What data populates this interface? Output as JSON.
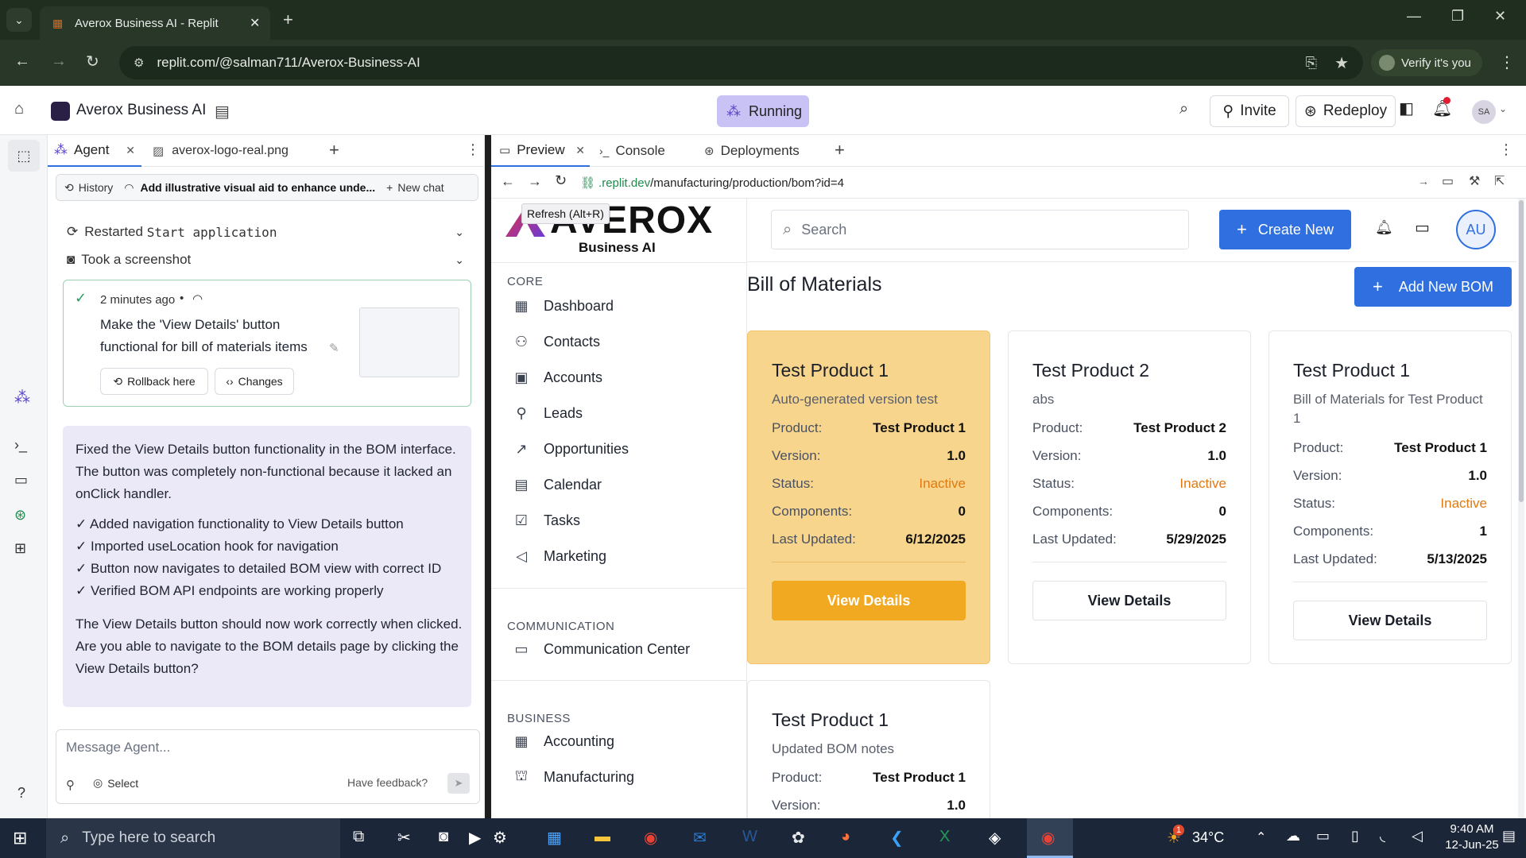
{
  "browser": {
    "tab_title": "Averox Business AI - Replit",
    "url": "replit.com/@salman711/Averox-Business-AI",
    "verify_label": "Verify it's you"
  },
  "replit": {
    "project_name": "Averox Business AI",
    "running_label": "Running",
    "invite_label": "Invite",
    "redeploy_label": "Redeploy",
    "avatar": "SA"
  },
  "agent_tabs": [
    {
      "label": "Agent"
    },
    {
      "label": "averox-logo-real.png"
    }
  ],
  "agent": {
    "history_label": "History",
    "chat_title": "Add illustrative visual aid to enhance unde...",
    "new_chat_label": "New chat",
    "log_items": [
      {
        "prefix": "Restarted ",
        "code": "Start application"
      },
      {
        "prefix": "Took a screenshot",
        "code": ""
      }
    ],
    "checkpoint": {
      "time": "2 minutes ago",
      "text": "Make the 'View Details' button functional for bill of materials items",
      "rollback_label": "Rollback here",
      "changes_label": "Changes"
    },
    "message": {
      "intro": "Fixed the View Details button functionality in the BOM interface. The button was completely non-functional because it lacked an onClick handler.",
      "checks": [
        "✓ Added navigation functionality to View Details button",
        "✓ Imported useLocation hook for navigation",
        "✓ Button now navigates to detailed BOM view with correct ID",
        "✓ Verified BOM API endpoints are working properly"
      ],
      "outro": "The View Details button should now work correctly when clicked. Are you able to navigate to the BOM details page by clicking the View Details button?"
    },
    "input_placeholder": "Message Agent...",
    "select_label": "Select",
    "feedback_label": "Have feedback?"
  },
  "preview_tabs": [
    {
      "label": "Preview"
    },
    {
      "label": "Console"
    },
    {
      "label": "Deployments"
    }
  ],
  "preview": {
    "url_host": ".replit.dev",
    "url_path": "/manufacturing/production/bom?id=4",
    "tooltip": "Refresh (Alt+R)"
  },
  "app": {
    "logo_text": "AVEROX",
    "logo_sub": "Business AI",
    "search_placeholder": "Search",
    "create_new_label": "Create New",
    "user_avatar": "AU",
    "page_title": "Bill of Materials",
    "add_bom_label": "Add New BOM",
    "sections": [
      {
        "title": "CORE",
        "items": [
          "Dashboard",
          "Contacts",
          "Accounts",
          "Leads",
          "Opportunities",
          "Calendar",
          "Tasks",
          "Marketing"
        ]
      },
      {
        "title": "COMMUNICATION",
        "items": [
          "Communication Center"
        ]
      },
      {
        "title": "BUSINESS",
        "items": [
          "Accounting",
          "Manufacturing"
        ]
      }
    ],
    "labels": {
      "product": "Product:",
      "version": "Version:",
      "status": "Status:",
      "components": "Components:",
      "updated": "Last Updated:",
      "view": "View Details"
    },
    "boms": [
      {
        "name": "Test Product 1",
        "desc": "Auto-generated version test",
        "product": "Test Product 1",
        "version": "1.0",
        "status": "Inactive",
        "components": "0",
        "updated": "6/12/2025"
      },
      {
        "name": "Test Product 2",
        "desc": "abs",
        "product": "Test Product 2",
        "version": "1.0",
        "status": "Inactive",
        "components": "0",
        "updated": "5/29/2025"
      },
      {
        "name": "Test Product 1",
        "desc": "Bill of Materials for Test Product 1",
        "product": "Test Product 1",
        "version": "1.0",
        "status": "Inactive",
        "components": "1",
        "updated": "5/13/2025"
      },
      {
        "name": "Test Product 1",
        "desc": "Updated BOM notes",
        "product": "Test Product 1",
        "version": "1.0"
      }
    ]
  },
  "taskbar": {
    "search_placeholder": "Type here to search",
    "temperature": "34°C",
    "time": "9:40 AM",
    "date": "12-Jun-25",
    "notification_count": "1"
  },
  "colors": {
    "accent_blue": "#2f6fdf",
    "highlight_card": "#f8d58c",
    "view_btn_orange": "#f2a922",
    "inactive": "#e07a10",
    "running_bg": "#c9c2f4"
  }
}
